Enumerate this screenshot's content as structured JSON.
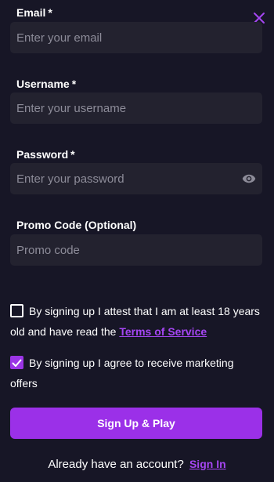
{
  "form": {
    "email": {
      "label": "Email",
      "required_mark": "*",
      "value": "",
      "placeholder": "Enter your email"
    },
    "username": {
      "label": "Username",
      "required_mark": "*",
      "value": "",
      "placeholder": "Enter your username"
    },
    "password": {
      "label": "Password",
      "required_mark": "*",
      "value": "",
      "placeholder": "Enter your password",
      "toggle_icon": "eye-icon"
    },
    "promo": {
      "label": "Promo Code (Optional)",
      "value": "",
      "placeholder": "Promo code"
    }
  },
  "consents": {
    "age": {
      "checked": false,
      "text": "By signing up I attest that I am at least 18 years old and have read the",
      "link_text": "Terms of Service"
    },
    "marketing": {
      "checked": true,
      "text": "By signing up I agree to receive marketing offers"
    }
  },
  "submit_label": "Sign Up & Play",
  "footer": {
    "prompt": "Already have an account?",
    "link_text": "Sign In"
  },
  "icons": {
    "close": "close-icon",
    "checkmark": "checkmark-icon"
  },
  "colors": {
    "background": "#171626",
    "field_bg": "#23222f",
    "accent": "#9b30e8",
    "link": "#a546f2",
    "placeholder": "#8d8c99"
  }
}
